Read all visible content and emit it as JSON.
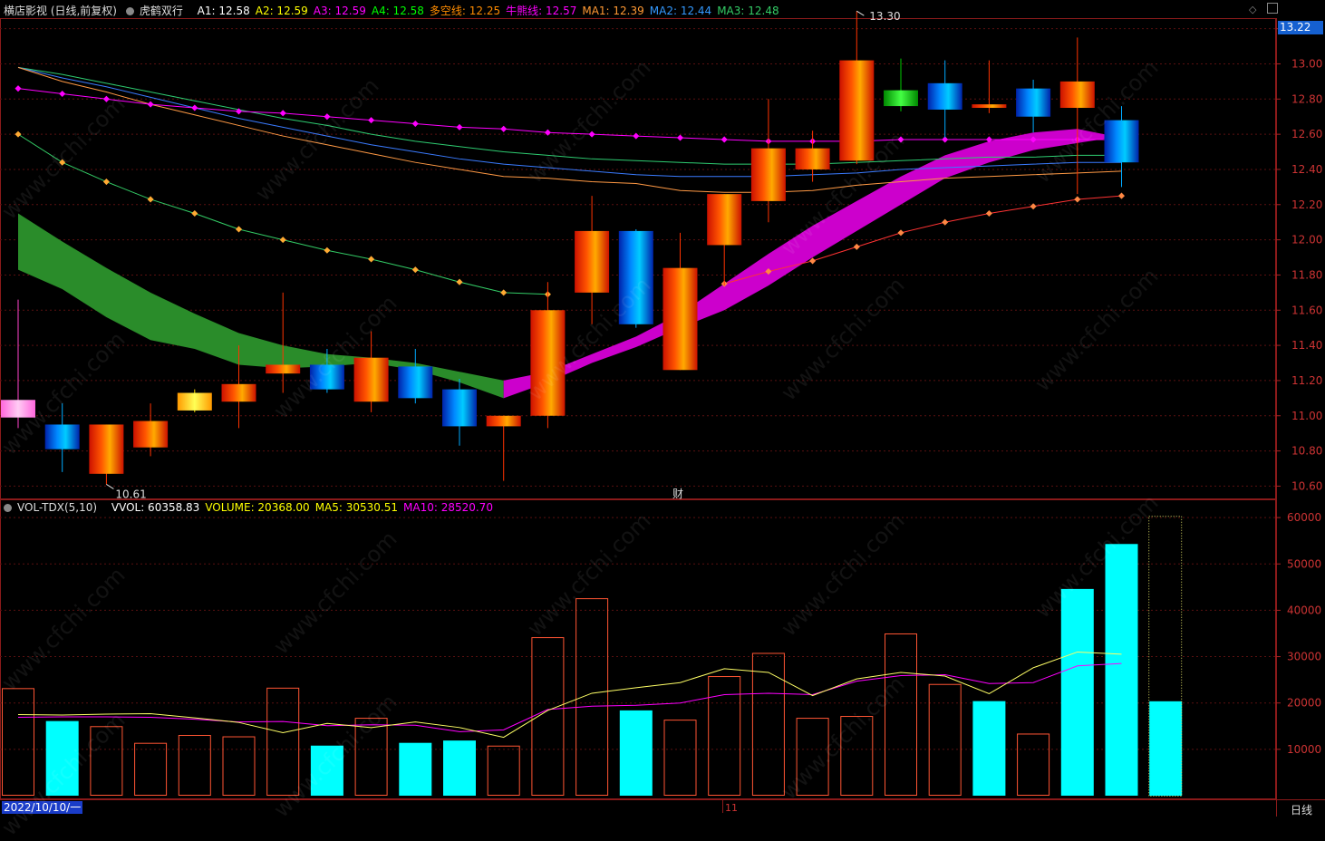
{
  "price_legend": {
    "stock": "横店影视 (日线,前复权)",
    "indicator": "虎鹤双行",
    "items": [
      {
        "label": "A1: 12.58",
        "color": "#ffffff"
      },
      {
        "label": "A2: 12.59",
        "color": "#ffff00"
      },
      {
        "label": "A3: 12.59",
        "color": "#ff00ff"
      },
      {
        "label": "A4: 12.58",
        "color": "#00ff00"
      },
      {
        "label": "多空线: 12.25",
        "color": "#ff8c00"
      },
      {
        "label": "牛熊线: 12.57",
        "color": "#ff00ff"
      },
      {
        "label": "MA1: 12.39",
        "color": "#ff9933"
      },
      {
        "label": "MA2: 12.44",
        "color": "#3399ff"
      },
      {
        "label": "MA3: 12.48",
        "color": "#33cc66"
      }
    ]
  },
  "vol_legend": {
    "indicator": "VOL-TDX(5,10)",
    "items": [
      {
        "label": "VVOL: 60358.83",
        "color": "#ffffff"
      },
      {
        "label": "VOLUME: 20368.00",
        "color": "#ffff00"
      },
      {
        "label": "MA5: 30530.51",
        "color": "#ffff00"
      },
      {
        "label": "MA10: 28520.70",
        "color": "#ff00ff"
      }
    ]
  },
  "current_price": "13.22",
  "date_label": "2022/10/10/一",
  "period_label": "日线",
  "month_label": "11",
  "finance_marker": "财",
  "high_annotation": "13.30",
  "low_annotation": "10.61",
  "watermark": "www.cfchi.com",
  "chart_data": [
    {
      "type": "candlestick",
      "y_ticks": [
        "13.20",
        "13.00",
        "12.80",
        "12.60",
        "12.40",
        "12.20",
        "12.00",
        "11.80",
        "11.60",
        "11.40",
        "11.20",
        "11.00",
        "10.80",
        "10.60"
      ],
      "ylim": [
        10.53,
        13.26
      ],
      "candles": [
        {
          "o": 10.99,
          "c": 11.09,
          "h": 11.66,
          "l": 10.93,
          "style": "pink"
        },
        {
          "o": 10.95,
          "c": 10.81,
          "h": 11.07,
          "l": 10.68,
          "style": "down"
        },
        {
          "o": 10.67,
          "c": 10.95,
          "h": 10.95,
          "l": 10.61,
          "style": "up"
        },
        {
          "o": 10.82,
          "c": 10.97,
          "h": 11.07,
          "l": 10.77,
          "style": "up"
        },
        {
          "o": 11.03,
          "c": 11.13,
          "h": 11.15,
          "l": 11.02,
          "style": "yellow"
        },
        {
          "o": 11.08,
          "c": 11.18,
          "h": 11.4,
          "l": 10.93,
          "style": "up"
        },
        {
          "o": 11.24,
          "c": 11.29,
          "h": 11.7,
          "l": 11.13,
          "style": "up"
        },
        {
          "o": 11.29,
          "c": 11.15,
          "h": 11.38,
          "l": 11.13,
          "style": "down"
        },
        {
          "o": 11.08,
          "c": 11.33,
          "h": 11.48,
          "l": 11.02,
          "style": "up"
        },
        {
          "o": 11.28,
          "c": 11.1,
          "h": 11.38,
          "l": 11.07,
          "style": "down"
        },
        {
          "o": 11.15,
          "c": 10.94,
          "h": 11.21,
          "l": 10.83,
          "style": "down"
        },
        {
          "o": 10.94,
          "c": 11.0,
          "h": 11.0,
          "l": 10.63,
          "style": "up"
        },
        {
          "o": 11.0,
          "c": 11.6,
          "h": 11.76,
          "l": 10.93,
          "style": "up"
        },
        {
          "o": 11.7,
          "c": 12.05,
          "h": 12.25,
          "l": 11.52,
          "style": "up"
        },
        {
          "o": 12.05,
          "c": 11.52,
          "h": 12.06,
          "l": 11.5,
          "style": "down"
        },
        {
          "o": 11.26,
          "c": 11.84,
          "h": 12.04,
          "l": 11.26,
          "style": "up"
        },
        {
          "o": 11.97,
          "c": 12.26,
          "h": 12.26,
          "l": 11.74,
          "style": "up"
        },
        {
          "o": 12.22,
          "c": 12.52,
          "h": 12.8,
          "l": 12.1,
          "style": "up"
        },
        {
          "o": 12.4,
          "c": 12.52,
          "h": 12.62,
          "l": 12.33,
          "style": "up"
        },
        {
          "o": 12.45,
          "c": 13.02,
          "h": 13.3,
          "l": 12.43,
          "style": "up"
        },
        {
          "o": 12.85,
          "c": 12.76,
          "h": 13.03,
          "l": 12.73,
          "style": "green"
        },
        {
          "o": 12.89,
          "c": 12.74,
          "h": 13.02,
          "l": 12.58,
          "style": "down"
        },
        {
          "o": 12.75,
          "c": 12.77,
          "h": 13.02,
          "l": 12.72,
          "style": "up"
        },
        {
          "o": 12.86,
          "c": 12.7,
          "h": 12.91,
          "l": 12.61,
          "style": "down"
        },
        {
          "o": 12.75,
          "c": 12.9,
          "h": 13.15,
          "l": 12.26,
          "style": "up"
        },
        {
          "o": 12.68,
          "c": 12.44,
          "h": 12.76,
          "l": 12.3,
          "style": "down"
        }
      ],
      "series": [
        {
          "key": "ma3",
          "color": "#2ecc71",
          "values": [
            12.98,
            12.94,
            12.89,
            12.84,
            12.79,
            12.74,
            12.69,
            12.65,
            12.6,
            12.56,
            12.53,
            12.5,
            12.48,
            12.46,
            12.45,
            12.44,
            12.43,
            12.43,
            12.43,
            12.44,
            12.45,
            12.46,
            12.47,
            12.47,
            12.48,
            12.48
          ]
        },
        {
          "key": "ma2",
          "color": "#3a7bff",
          "values": [
            12.98,
            12.92,
            12.87,
            12.81,
            12.75,
            12.69,
            12.64,
            12.59,
            12.54,
            12.5,
            12.46,
            12.43,
            12.41,
            12.39,
            12.37,
            12.36,
            12.36,
            12.36,
            12.37,
            12.38,
            12.4,
            12.41,
            12.42,
            12.43,
            12.44,
            12.44
          ]
        },
        {
          "key": "ma1",
          "color": "#ff9944",
          "values": [
            12.98,
            12.9,
            12.84,
            12.77,
            12.71,
            12.65,
            12.59,
            12.54,
            12.49,
            12.44,
            12.4,
            12.36,
            12.35,
            12.33,
            12.32,
            12.28,
            12.27,
            12.27,
            12.28,
            12.31,
            12.33,
            12.35,
            12.36,
            12.37,
            12.38,
            12.39
          ]
        },
        {
          "key": "bull_bear",
          "color": "#ff00ff",
          "dotted": true,
          "values": [
            12.86,
            12.83,
            12.8,
            12.77,
            12.75,
            12.73,
            12.72,
            12.7,
            12.68,
            12.66,
            12.64,
            12.63,
            12.61,
            12.6,
            12.59,
            12.58,
            12.57,
            12.56,
            12.56,
            12.56,
            12.57,
            12.57,
            12.57,
            12.57,
            12.57,
            12.57
          ]
        },
        {
          "key": "long_short_1",
          "color": "#33cc66",
          "dotted": true,
          "values": [
            12.6,
            12.44,
            12.33,
            12.23,
            12.15,
            12.06,
            12.0,
            11.94,
            11.89,
            11.83,
            11.76,
            11.7,
            11.69,
            null,
            null,
            null,
            null,
            null,
            null,
            null,
            null,
            null,
            null,
            null,
            null,
            null
          ]
        },
        {
          "key": "long_short_2",
          "color": "#ff3333",
          "dotted": true,
          "values": [
            null,
            null,
            null,
            null,
            null,
            null,
            null,
            null,
            null,
            null,
            null,
            null,
            null,
            null,
            null,
            null,
            11.75,
            11.82,
            11.88,
            11.96,
            12.04,
            12.1,
            12.15,
            12.19,
            12.23,
            12.25
          ]
        }
      ],
      "band": {
        "upper": [
          12.15,
          11.99,
          11.84,
          11.7,
          11.58,
          11.47,
          11.4,
          11.35,
          11.33,
          11.3,
          11.25,
          11.2,
          11.25,
          11.35,
          11.45,
          11.58,
          11.75,
          11.92,
          12.08,
          12.22,
          12.36,
          12.48,
          12.56,
          12.61,
          12.63,
          12.58
        ],
        "lower": [
          11.83,
          11.72,
          11.56,
          11.43,
          11.38,
          11.29,
          11.27,
          11.28,
          11.3,
          11.26,
          11.19,
          11.1,
          11.19,
          11.3,
          11.39,
          11.5,
          11.6,
          11.74,
          11.9,
          12.05,
          12.2,
          12.35,
          12.44,
          12.51,
          12.55,
          12.59
        ],
        "color_before": "#2a8c2a",
        "color_after": "#cc00cc"
      }
    },
    {
      "type": "bar",
      "y_ticks": [
        "60000",
        "50000",
        "40000",
        "30000",
        "20000",
        "10000"
      ],
      "ylim": [
        0,
        61000
      ],
      "volumes": [
        23200,
        16100,
        15000,
        11400,
        13100,
        12800,
        23300,
        10800,
        16800,
        11400,
        11900,
        10800,
        34200,
        42600,
        18400,
        16400,
        25800,
        30800,
        16800,
        17200,
        35000,
        24100,
        20400,
        13400,
        44600,
        54300,
        20368
      ],
      "filled": [
        false,
        true,
        false,
        false,
        false,
        false,
        false,
        true,
        false,
        true,
        true,
        false,
        false,
        false,
        true,
        false,
        false,
        false,
        false,
        false,
        false,
        false,
        true,
        false,
        true,
        true,
        true
      ],
      "vvol_last": 60358.83,
      "ma5": [
        17500,
        17400,
        17600,
        17700,
        16800,
        15800,
        13600,
        15600,
        14700,
        15900,
        14700,
        12600,
        18400,
        22100,
        23300,
        24400,
        27400,
        26600,
        21600,
        25200,
        26600,
        25800,
        22000,
        27600,
        31000,
        30530
      ],
      "ma10": [
        16900,
        17000,
        17000,
        16900,
        16500,
        15900,
        16000,
        15100,
        15300,
        15200,
        13800,
        14200,
        18600,
        19300,
        19500,
        20000,
        21800,
        22100,
        21800,
        24700,
        25900,
        26100,
        24200,
        24400,
        28000,
        28520
      ]
    }
  ]
}
